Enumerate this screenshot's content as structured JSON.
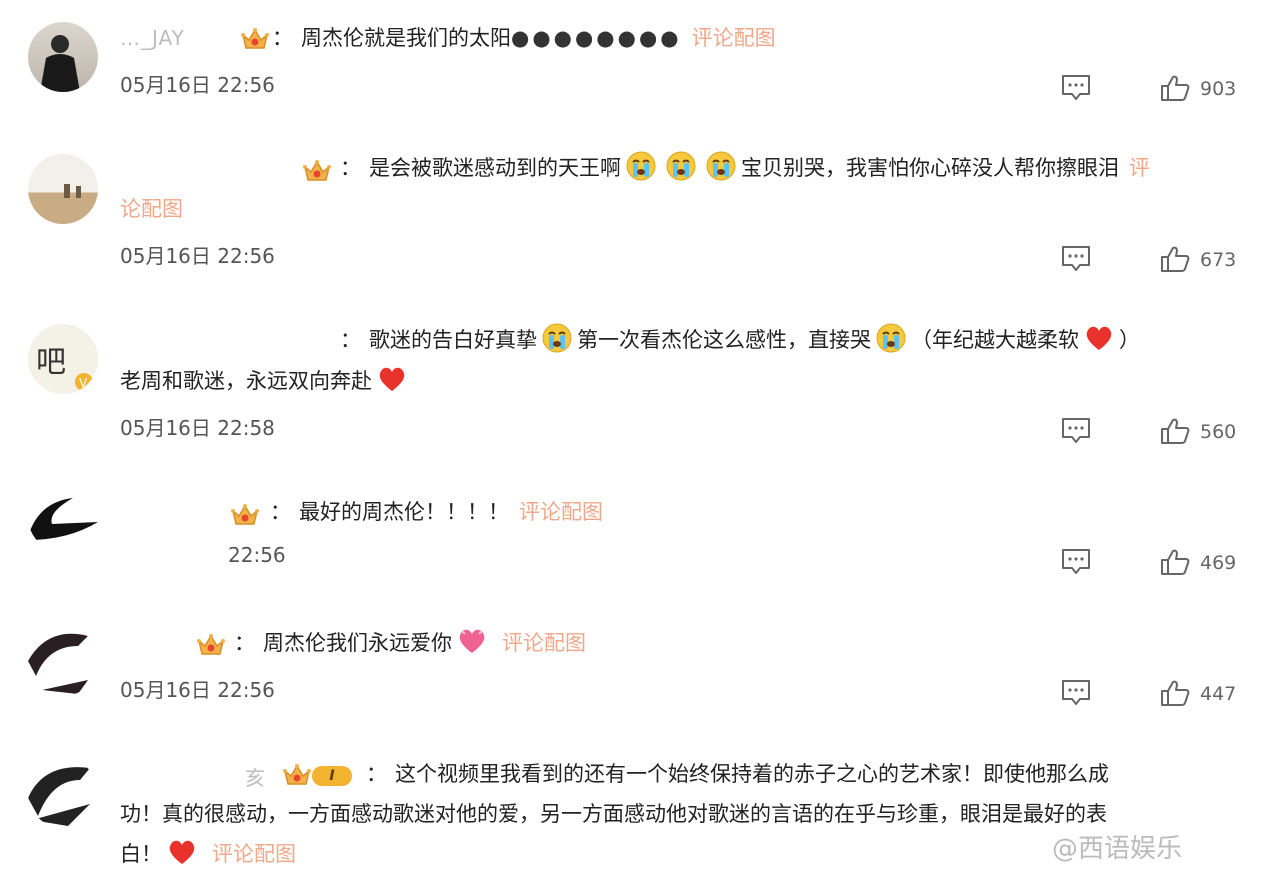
{
  "comments": [
    {
      "username": "…_JAY",
      "lines": [
        "周杰伦就是我们的太阳",
        ""
      ],
      "dots": "●●●●●●●●",
      "pic_link": "评论配图",
      "time": "05月16日 22:56",
      "likes": "903"
    },
    {
      "username": "",
      "line1_a": "是会被歌迷感动到的天王啊",
      "line1_b": "宝贝别哭，我害怕你心碎没人帮你擦眼泪",
      "pic_link_a": "评",
      "pic_link_b": "论配图",
      "time": "05月16日 22:56",
      "likes": "673"
    },
    {
      "username": "",
      "line1_a": "歌迷的告白好真挚",
      "line1_b": "第一次看杰伦这么感性，直接哭",
      "line1_c": "（年纪越大越柔软",
      "line1_d": "）",
      "line2": "老周和歌迷，永远双向奔赴",
      "time": "05月16日 22:58",
      "likes": "560"
    },
    {
      "username": "",
      "line1": "最好的周杰伦！！！！",
      "pic_link": "评论配图",
      "time": "22:56",
      "likes": "469"
    },
    {
      "username": "",
      "line1": "周杰伦我们永远爱你",
      "pic_link": "评论配图",
      "time": "05月16日 22:56",
      "likes": "447"
    },
    {
      "username": "亥",
      "line1": "这个视频里我看到的还有一个始终保持着的赤子之心的艺术家！即使他那么成",
      "line2": "功！真的很感动，一方面感动歌迷对他的爱，另一方面感动他对歌迷的言语的在乎与珍重，眼泪是最好的表",
      "line3": "白！",
      "pic_link": "评论配图"
    }
  ],
  "colon": "：",
  "watermark": "@西语娱乐",
  "colors": {
    "link": "#f0a88a",
    "heart": "#e8322b",
    "crown": "#e8a33a"
  },
  "icons": [
    "reply-icon",
    "like-icon",
    "crown-icon",
    "crying-emoji",
    "heart-emoji"
  ]
}
